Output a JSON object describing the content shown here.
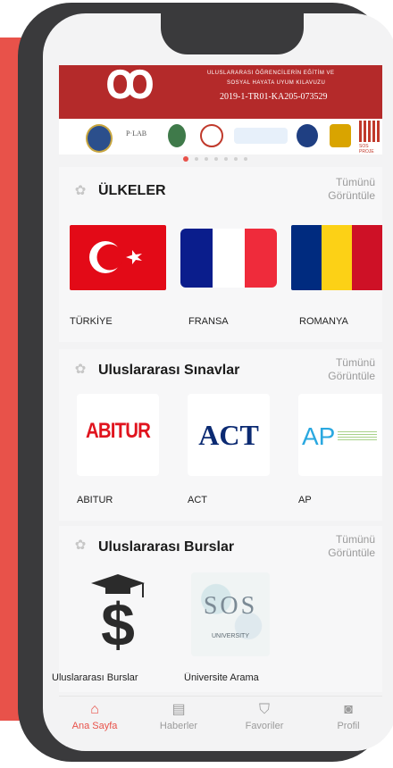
{
  "banner": {
    "line1": "ULUSLARARASI ÖĞRENCİLERİN EĞİTİM VE",
    "line2": "SOSYAL HAYATA UYUM KILAVUZU",
    "line3": "2019-1-TR01-KA205-073529",
    "logo_text": "SOS PROJE"
  },
  "sections": {
    "countries": {
      "title": "ÜLKELER",
      "more": "Tümünü Görüntüle",
      "items": [
        {
          "label": "TÜRKİYE"
        },
        {
          "label": "FRANSA"
        },
        {
          "label": "ROMANYA"
        }
      ]
    },
    "exams": {
      "title": "Uluslararası Sınavlar",
      "more": "Tümünü Görüntüle",
      "items": [
        {
          "label": "ABITUR",
          "logo": "ABITUR"
        },
        {
          "label": "ACT",
          "logo": "ACT"
        },
        {
          "label": "AP",
          "logo": "AP"
        }
      ]
    },
    "scholarships": {
      "title": "Uluslararası Burslar",
      "more": "Tümünü Görüntüle",
      "items": [
        {
          "label": "Uluslararası Burslar"
        },
        {
          "label": "Üniversite Arama"
        }
      ],
      "sos_text": "SOS",
      "sos_sub": "UNIVERSITY"
    }
  },
  "tabs": [
    {
      "label": "Ana Sayfa",
      "icon": "home-icon"
    },
    {
      "label": "Haberler",
      "icon": "news-icon"
    },
    {
      "label": "Favoriler",
      "icon": "bookmark-icon"
    },
    {
      "label": "Profil",
      "icon": "profile-icon"
    }
  ],
  "colors": {
    "accent": "#e8524a",
    "banner": "#b42a2a"
  }
}
